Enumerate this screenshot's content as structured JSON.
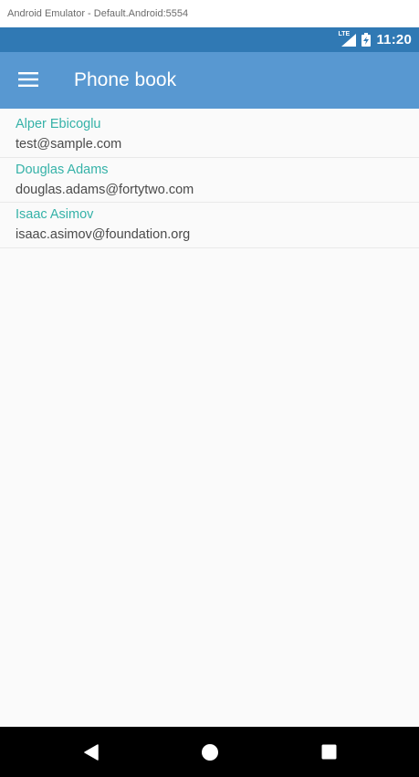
{
  "window": {
    "title": "Android Emulator - Default.Android:5554"
  },
  "status_bar": {
    "network_label": "LTE",
    "signal_icon": "signal-icon",
    "battery_icon": "battery-charging-icon",
    "time": "11:20",
    "color": "#3079b4"
  },
  "app_bar": {
    "menu_icon": "hamburger-menu-icon",
    "title": "Phone book",
    "color": "#5898d1"
  },
  "contacts": [
    {
      "name": "Alper Ebicoglu",
      "email": "test@sample.com"
    },
    {
      "name": "Douglas Adams",
      "email": "douglas.adams@fortytwo.com"
    },
    {
      "name": "Isaac Asimov",
      "email": "isaac.asimov@foundation.org"
    }
  ],
  "nav_bar": {
    "back_icon": "back-triangle-icon",
    "home_icon": "home-circle-icon",
    "recents_icon": "recents-square-icon"
  },
  "colors": {
    "accent_name": "#35b2a8",
    "email_text": "#4a4a4a",
    "background": "#fafafa"
  }
}
